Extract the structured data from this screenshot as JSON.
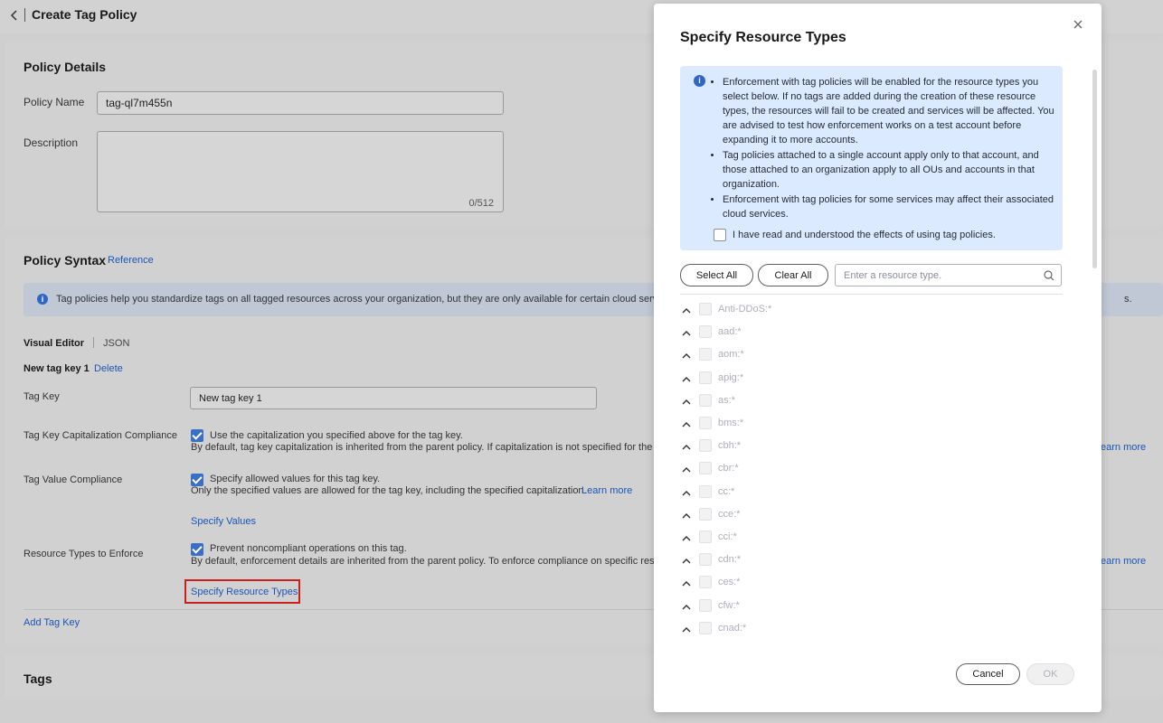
{
  "page": {
    "title": "Create Tag Policy"
  },
  "policy_details": {
    "section_title": "Policy Details",
    "name_label": "Policy Name",
    "name_value": "tag-ql7m455n",
    "description_label": "Description",
    "description_counter": "0/512"
  },
  "policy_syntax": {
    "section_title": "Policy Syntax",
    "reference_link": "Reference",
    "banner_text": "Tag policies help you standardize tags on all tagged resources across your organization, but they are only available for certain cloud servic",
    "banner_tail": "s.",
    "tab_visual": "Visual Editor",
    "tab_json": "JSON",
    "tag_key_title": "New tag key 1",
    "delete_link": "Delete",
    "tag_key_label": "Tag Key",
    "tag_key_value": "New tag key 1",
    "cap_label": "Tag Key Capitalization Compliance",
    "cap_check": "Use the capitalization you specified above for the tag key.",
    "cap_desc": "By default, tag key capitalization is inherited from the parent policy. If capitalization is not specified for the pa",
    "cap_learn": "earn more",
    "val_label": "Tag Value Compliance",
    "val_check": "Specify allowed values for this tag key.",
    "val_desc": "Only the specified values are allowed for the tag key, including the specified capitalization.",
    "val_learn": "Learn more",
    "specify_values": "Specify Values",
    "res_label": "Resource Types to Enforce",
    "res_check": "Prevent noncompliant operations on this tag.",
    "res_desc": "By default, enforcement details are inherited from the parent policy. To enforce compliance on specific resou",
    "res_learn": "earn more",
    "specify_resource_types": "Specify Resource Types",
    "add_tag_key": "Add Tag Key"
  },
  "tags_section": {
    "section_title": "Tags"
  },
  "dialog": {
    "title": "Specify Resource Types",
    "notes": [
      "Enforcement with tag policies will be enabled for the resource types you select below. If no tags are added during the creation of these resource types, the resources will fail to be created and services will be affected. You are advised to test how enforcement works on a test account before expanding it to more accounts.",
      "Tag policies attached to a single account apply only to that account, and those attached to an organization apply to all OUs and accounts in that organization.",
      "Enforcement with tag policies for some services may affect their associated cloud services."
    ],
    "acknowledge": "I have read and understood the effects of using tag policies.",
    "select_all": "Select All",
    "clear_all": "Clear All",
    "search_placeholder": "Enter a resource type.",
    "resource_types": [
      "Anti-DDoS:*",
      "aad:*",
      "aom:*",
      "apig:*",
      "as:*",
      "bms:*",
      "cbh:*",
      "cbr:*",
      "cc:*",
      "cce:*",
      "cci:*",
      "cdn:*",
      "ces:*",
      "cfw:*",
      "cnad:*"
    ],
    "cancel": "Cancel",
    "ok": "OK"
  }
}
